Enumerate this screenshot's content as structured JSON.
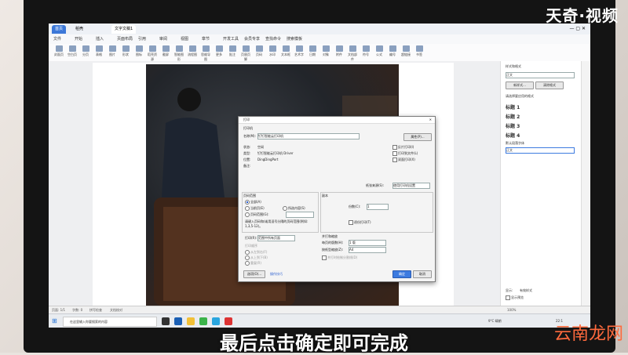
{
  "brand": "天奇·视频",
  "subtitle": "最后点击确定即可完成",
  "watermark": "云南龙网",
  "tabs": [
    {
      "label": "首页",
      "active": false
    },
    {
      "label": "稻壳",
      "active": false
    },
    {
      "label": "文字文稿1",
      "active": true
    }
  ],
  "menu": [
    "文件",
    "开始",
    "插入",
    "页面布局",
    "引用",
    "审阅",
    "视图",
    "章节",
    "开发工具",
    "会员专享",
    "查找命令",
    "搜索模板"
  ],
  "ribbon": [
    "封面页",
    "空白页",
    "分页",
    "表格",
    "图片",
    "形状",
    "图标",
    "稻壳资源",
    "截屏",
    "智能图形",
    "流程图",
    "思维导图",
    "更多",
    "批注",
    "页眉页脚",
    "页码",
    "水印",
    "文本框",
    "艺术字",
    "日期",
    "对象",
    "附件",
    "文档部件",
    "符号",
    "公式",
    "编号",
    "超链接",
    "书签"
  ],
  "dialog": {
    "title": "打印",
    "printer_section": "打印机",
    "name_label": "名称(M):",
    "printer_name": "钉钉智能云打印机",
    "properties_button": "属性(P)...",
    "status_label": "状态:",
    "status_value": "空闲",
    "type_label": "类型:",
    "type_value": "钉钉智能云打印机 Driver",
    "where_label": "位置:",
    "where_value": "DingDingPort",
    "comment_label": "备注:",
    "reverse_print": "反片打印(I)",
    "print_to_file": "打印到文件(L)",
    "duplex": "双面打印(X)",
    "paper_source_label": "纸张来源(S):",
    "paper_source_value": "使用打印机设置",
    "range_section": "页码范围",
    "range_all": "全部(A)",
    "range_current": "当前页(E)",
    "range_selection": "所选内容(S)",
    "range_pages": "页码范围(G):",
    "range_hint": "请键入页码和/或用逗号分隔的页码范围(例如: 1,3,5-12)。",
    "print_label": "打印(R):",
    "print_value": "范围中所有页面",
    "parallel_section": "并打和缩放",
    "copies_section": "副本",
    "copies_label": "份数(C):",
    "copies_value": "1",
    "collate": "逐份打印(T)",
    "per_sheet_label": "每页的版数(H):",
    "per_sheet_value": "1 版",
    "scale_label": "按纸型缩放(Z):",
    "scale_value": "A4",
    "order_label": "打印顺序",
    "order_lr": "从左到右(F)",
    "order_tb": "从上到下(B)",
    "order_repeat": "重复(R)",
    "order_no_scale": "并打时绘制分割线(D)",
    "options_button": "选项(O)...",
    "tips_link": "操作技巧",
    "ok_button": "确定",
    "cancel_button": "取消"
  },
  "panel": {
    "title": "样式和格式",
    "current_style": "正文",
    "new_style": "新样式...",
    "clear_format": "清除格式",
    "apply_label": "请选择要应用的格式",
    "styles": [
      "标题 1",
      "标题 2",
      "标题 3",
      "标题 4"
    ],
    "default_font": "默认段落字体",
    "body_style": "正文",
    "show_label": "显示:",
    "show_value": "有效样式",
    "preview": "显示预览"
  },
  "status": {
    "page": "页面: 1/1",
    "words": "字数: 0",
    "spell": "拼写检查",
    "proof": "文档校对",
    "zoom": "100%"
  },
  "taskbar": {
    "search": "在这里输入你要搜索的内容",
    "weather": "9°C 晴朗",
    "time": "22:1"
  },
  "colors": {
    "accent": "#3d7be0",
    "tab_active": "#ffffff",
    "brand_text": "#ffffff"
  }
}
